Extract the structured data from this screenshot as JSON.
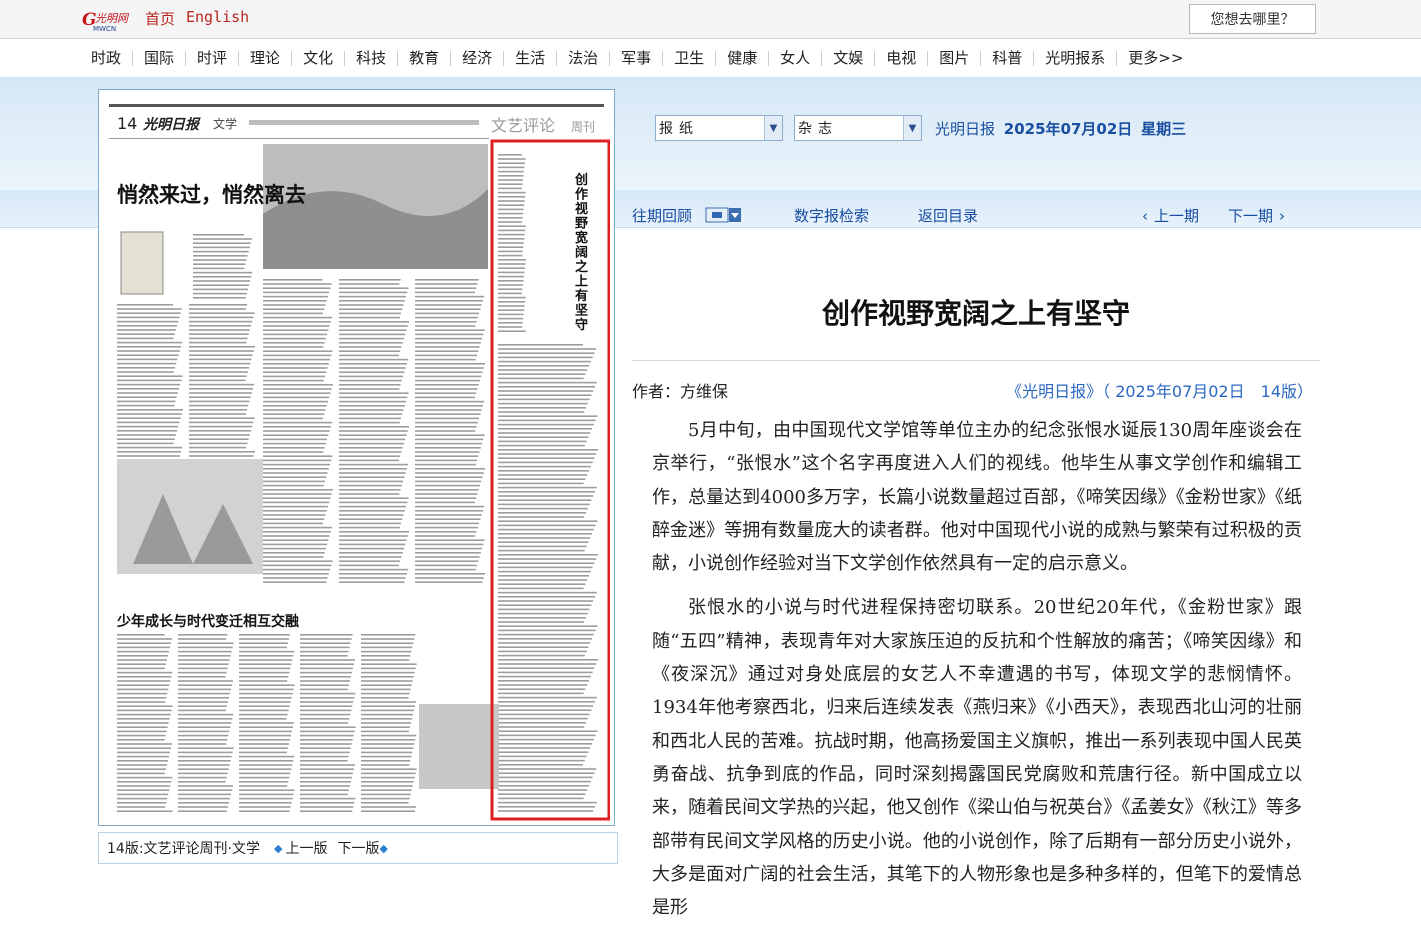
{
  "topbar": {
    "logo_alt": "光明网",
    "home": "首页",
    "english": "English",
    "search_box": "您想去哪里？"
  },
  "nav": [
    "时政",
    "国际",
    "时评",
    "理论",
    "文化",
    "科技",
    "教育",
    "经济",
    "生活",
    "法治",
    "军事",
    "卫生",
    "健康",
    "女人",
    "文娱",
    "电视",
    "图片",
    "科普",
    "光明报系",
    "更多>>"
  ],
  "selectors": {
    "paper": "报纸",
    "magazine": "杂志",
    "paper_name": "光明日报",
    "date": "2025年07月02日",
    "weekday": "星期三"
  },
  "issue_nav": {
    "past": "往期回顾",
    "digital": "数字报检索",
    "back": "返回目录",
    "prev_issue": "上一期",
    "next_issue": "下一期"
  },
  "paper_thumb": {
    "page_no": "14",
    "masthead": "光明日报",
    "section": "文学",
    "column": "文艺评论",
    "column_tag": "周刊",
    "article1": "悄然来过，悄然离去",
    "article2": "少年成长与时代变迁相互交融",
    "highlight": "创作视野宽阔之上有坚守"
  },
  "paper_footer": {
    "page": "14版:文艺评论周刊·文学",
    "prev": "上一版",
    "next": "下一版"
  },
  "article": {
    "title": "创作视野宽阔之上有坚守",
    "author": "作者：方维保",
    "source": "《光明日报》（ 2025年07月02日　14版）",
    "paragraphs": [
      "5月中旬，由中国现代文学馆等单位主办的纪念张恨水诞辰130周年座谈会在京举行，“张恨水”这个名字再度进入人们的视线。他毕生从事文学创作和编辑工作，总量达到4000多万字，长篇小说数量超过百部，《啼笑因缘》《金粉世家》《纸醉金迷》等拥有数量庞大的读者群。他对中国现代小说的成熟与繁荣有过积极的贡献，小说创作经验对当下文学创作依然具有一定的启示意义。",
      "张恨水的小说与时代进程保持密切联系。20世纪20年代，《金粉世家》跟随“五四”精神，表现青年对大家族压迫的反抗和个性解放的痛苦；《啼笑因缘》和《夜深沉》通过对身处底层的女艺人不幸遭遇的书写，体现文学的悲悯情怀。1934年他考察西北，归来后连续发表《燕归来》《小西天》，表现西北山河的壮丽和西北人民的苦难。抗战时期，他高扬爱国主义旗帜，推出一系列表现中国人民英勇奋战、抗争到底的作品，同时深刻揭露国民党腐败和荒唐行径。新中国成立以来，随着民间文学热的兴起，他又创作《梁山伯与祝英台》《孟姜女》《秋江》等多部带有民间文学风格的历史小说。他的小说创作，除了后期有一部分历史小说外，大多是面对广阔的社会生活，其笔下的人物形象也是多种多样的，但笔下的爱情总是形"
    ]
  }
}
